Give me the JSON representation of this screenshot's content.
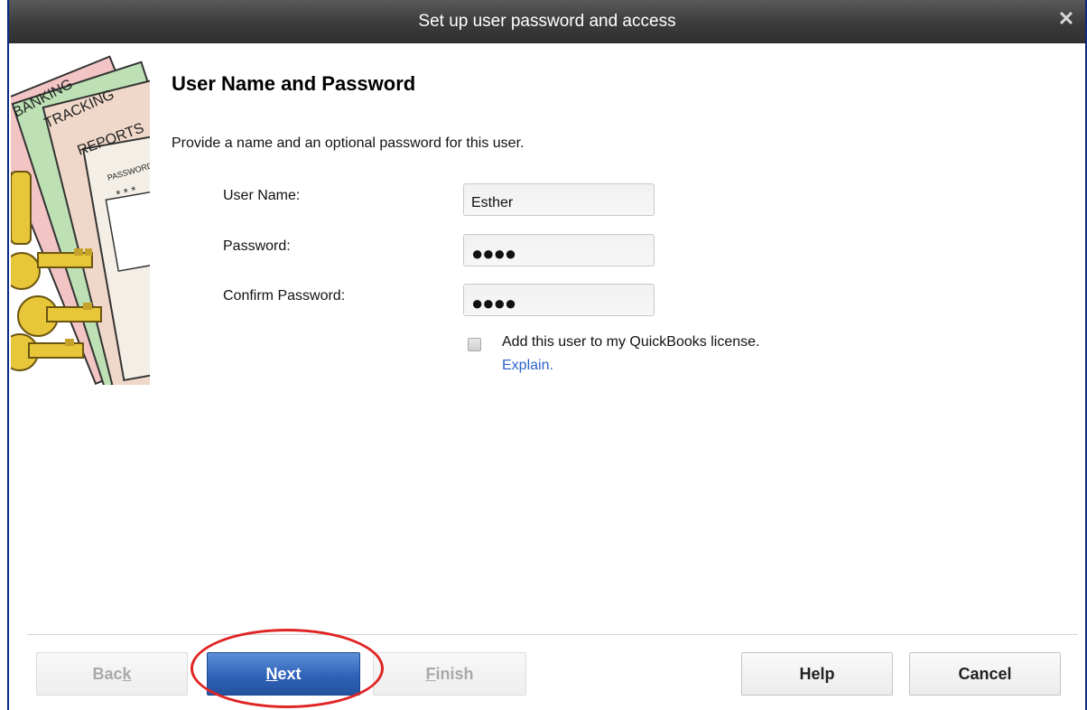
{
  "window": {
    "title": "Set up user password and access"
  },
  "illustration": {
    "tabs": [
      "BANKING",
      "TRACKING",
      "REPORTS",
      "PASSWORD"
    ],
    "stars": "* * *"
  },
  "page": {
    "heading": "User Name and Password",
    "instructions": "Provide a name and an optional password for this user."
  },
  "form": {
    "user_name": {
      "label": "User Name:",
      "value": "Esther"
    },
    "password": {
      "label": "Password:",
      "masked_value": "●●●●"
    },
    "confirm_password": {
      "label": "Confirm Password:",
      "masked_value": "●●●●"
    },
    "license_checkbox": {
      "label": "Add this user to my QuickBooks license.",
      "checked": false
    },
    "explain_link": "Explain."
  },
  "buttons": {
    "back": {
      "pre": "Bac",
      "accel": "k",
      "post": "",
      "enabled": false
    },
    "next": {
      "pre": "",
      "accel": "N",
      "post": "ext",
      "enabled": true
    },
    "finish": {
      "pre": "",
      "accel": "F",
      "post": "inish",
      "enabled": false
    },
    "help": "Help",
    "cancel": "Cancel"
  },
  "colors": {
    "titlebar": "#3b3b3b",
    "primary_button": "#2f63b8",
    "link": "#2c63c9",
    "highlight": "#e02424",
    "window_border": "#0a2a8c"
  }
}
